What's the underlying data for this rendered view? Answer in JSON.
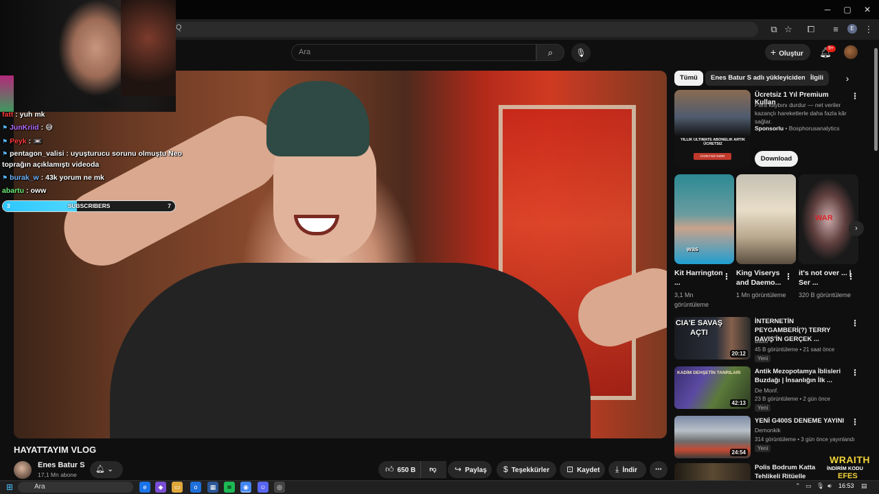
{
  "browser": {
    "window_controls": [
      "─",
      "▢",
      "✕"
    ],
    "address_query": "Q",
    "profile_initial": "E"
  },
  "youtube": {
    "search_placeholder": "Ara",
    "create_label": "Oluştur",
    "notification_count": "9+"
  },
  "stream_overlay": {
    "chat": [
      {
        "user": "fatt",
        "message": ": yuh mk",
        "color": "#ff3b3b",
        "badge": ""
      },
      {
        "user": "JunKriid",
        "message": ": 😅",
        "color": "#b56cff",
        "badge": "⚑"
      },
      {
        "user": "Peyk",
        "message": ": 📼",
        "color": "#ff3b3b",
        "badge": "⚑"
      },
      {
        "user": "pentagon_valisi",
        "message": ": uyuşturucu sorunu olmuştu Neo",
        "color": "#ffffff",
        "badge": "⚑"
      },
      {
        "user": "",
        "message": "toprağın açıklamıştı videoda",
        "color": "#ffffff",
        "badge": ""
      },
      {
        "user": "burak_w",
        "message": ": 43k yorum ne mk",
        "color": "#6fb5ff",
        "badge": "⚑"
      },
      {
        "user": "abartu",
        "message": ": oww",
        "color": "#6ef07a",
        "badge": ""
      }
    ],
    "subscribers": {
      "label": "SUBSCRIBERS",
      "current": "3",
      "goal": "7",
      "progress": 0.43
    }
  },
  "video": {
    "title": "HAYATTAYIM VLOG",
    "channel": "Enes Batur S",
    "subscribers": "17,1 Mn abone",
    "likes": "650 B",
    "share_label": "Paylaş",
    "thanks_label": "Teşekkürler",
    "save_label": "Kaydet",
    "download_label": "İndir"
  },
  "chips": [
    "Tümü",
    "Enes Batur S adlı yükleyiciden",
    "İlgili"
  ],
  "ad": {
    "title": "Ücretsiz 1 Yıl Premium Kullan",
    "description": "Para kaybını durdur — net veriler kazançlı hareketlerle daha fazla kâr sağlar.",
    "sponsored_label": "Sponsorlu",
    "sponsor": "Bosphorusanalytics",
    "cta": "Download",
    "thumb_text": "YILLIK ULTIMATE ABONELIK ARTIK ÜCRETSIZ",
    "thumb_button": "ÜCRETSİZ İNDİR"
  },
  "shorts": [
    {
      "title": "Kit Harrington ...",
      "views": "3,1 Mn görüntüleme",
      "caption": "was"
    },
    {
      "title": "King Viserys and Daemo...",
      "views": "1 Mn görüntüleme",
      "caption": ""
    },
    {
      "title": "it's not over ... | Ser ...",
      "views": "320 B görüntüleme",
      "caption": "WAR"
    }
  ],
  "recommendations": [
    {
      "title": "İNTERNETİN PEYGAMBERİ(?) TERRY DAVIS'İN GERÇEK ...",
      "channel": "Baso ✔",
      "meta": "45 B görüntüleme • 21 saat önce",
      "badge": "Yeni",
      "duration": "20:12",
      "thumb_text": "CIA'E SAVAŞ AÇTI"
    },
    {
      "title": "Antik Mezopotamya İblisleri Buzdağı | İnsanlığın İlk ...",
      "channel": "De Monf.",
      "meta": "23 B görüntüleme • 2 gün önce",
      "badge": "Yeni",
      "duration": "42:13",
      "thumb_text": "KADİM DEHŞETİN TANRILARI"
    },
    {
      "title": "YENİ G400S DENEME YAYINI",
      "channel": "Demonkik",
      "meta": "314 görüntüleme • 3 gün önce yayınlandı",
      "badge": "Yeni",
      "duration": "24:54",
      "thumb_text": ""
    },
    {
      "title": "Polis Bodrum Katta Tehlikeli Ritüelle Karşılaşıyor",
      "channel": "",
      "meta": "",
      "badge": "",
      "duration": "",
      "thumb_text": ""
    }
  ],
  "promo": {
    "line1": "WRAITH",
    "line2": "İNDİRİM KODU",
    "line3": "EFES"
  },
  "taskbar": {
    "search_placeholder": "Ara",
    "clock": "16:53"
  },
  "colors": {
    "accent_red": "#e62117",
    "sub_bar": "#2ec7ff",
    "promo_yellow": "#f3d43a"
  }
}
